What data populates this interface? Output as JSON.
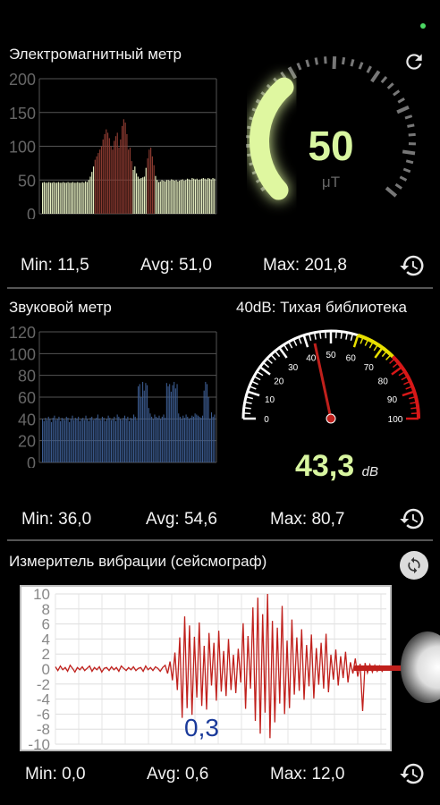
{
  "status": {
    "dot_color": "#4cd964"
  },
  "em": {
    "title": "Электромагнитный метр",
    "chart_data": {
      "type": "bar",
      "yticks": [
        "200",
        "150",
        "100",
        "50",
        "0"
      ],
      "ylim": [
        0,
        200
      ],
      "values": [
        46,
        47,
        46,
        46,
        47,
        46,
        46,
        47,
        46,
        46,
        47,
        46,
        46,
        47,
        46,
        46,
        47,
        46,
        46,
        47,
        46,
        46,
        47,
        46,
        46,
        47,
        46,
        48,
        47,
        50,
        55,
        62,
        70,
        80,
        85,
        90,
        95,
        100,
        110,
        118,
        125,
        120,
        112,
        100,
        95,
        108,
        115,
        120,
        98,
        110,
        130,
        140,
        135,
        118,
        95,
        98,
        78,
        65,
        70,
        60,
        55,
        52,
        53,
        54,
        55,
        68,
        82,
        95,
        98,
        85,
        72,
        56,
        50,
        47,
        48,
        50,
        49,
        48,
        50,
        50,
        49,
        51,
        50,
        49,
        50,
        48,
        49,
        50,
        51,
        49,
        50,
        52,
        51,
        50,
        53,
        52,
        51,
        52,
        50,
        51,
        52,
        53,
        52,
        51,
        53,
        52,
        51,
        53,
        52
      ],
      "threshold": 70,
      "colors": {
        "normal": "#e6efc2",
        "high": "#8a3a30"
      }
    },
    "gauge": {
      "value": "50",
      "unit": "μT",
      "fraction": 0.19
    },
    "stats": {
      "min": "Min: 11,5",
      "avg": "Avg: 51,0",
      "max": "Max: 201,8"
    }
  },
  "sound": {
    "title": "Звуковой метр",
    "status_text": "40dB: Тихая библиотека",
    "chart_data": {
      "type": "bar",
      "yticks": [
        "120",
        "100",
        "80",
        "60",
        "40",
        "20",
        "0"
      ],
      "ylim": [
        0,
        120
      ],
      "values": [
        40,
        38,
        41,
        39,
        42,
        40,
        37,
        41,
        43,
        39,
        40,
        42,
        38,
        41,
        40,
        39,
        42,
        41,
        37,
        40,
        43,
        39,
        41,
        40,
        42,
        38,
        40,
        41,
        39,
        43,
        40,
        38,
        41,
        42,
        39,
        40,
        41,
        44,
        40,
        39,
        42,
        41,
        38,
        40,
        43,
        41,
        39,
        40,
        42,
        38,
        44,
        42,
        40,
        39,
        41,
        43,
        40,
        42,
        38,
        41,
        40,
        44,
        42,
        39,
        70,
        72,
        60,
        74,
        66,
        73,
        71,
        50,
        45,
        42,
        40,
        44,
        42,
        41,
        43,
        40,
        42,
        44,
        41,
        73,
        70,
        72,
        65,
        71,
        74,
        68,
        72,
        45,
        42,
        40,
        43,
        41,
        44,
        42,
        40,
        41,
        43,
        42,
        45,
        44,
        43,
        42,
        41,
        43,
        66,
        74,
        72,
        60,
        40,
        46,
        42,
        44
      ]
    },
    "gauge": {
      "value": "43,3",
      "unit": "dB",
      "needle_value": 43.3,
      "labels": [
        "0",
        "10",
        "20",
        "30",
        "40",
        "50",
        "60",
        "70",
        "80",
        "90",
        "100"
      ]
    },
    "stats": {
      "min": "Min: 36,0",
      "avg": "Avg: 54,6",
      "max": "Max: 80,7"
    }
  },
  "vib": {
    "title": "Измеритель вибрации (сейсмограф)",
    "current": "0,3",
    "chart_data": {
      "type": "line",
      "yticks": [
        "10",
        "8",
        "6",
        "4",
        "2",
        "0",
        "-2",
        "-4",
        "-6",
        "-8",
        "-10"
      ],
      "ylim": [
        -10,
        10
      ],
      "values": [
        0.3,
        -0.2,
        0.4,
        -0.1,
        0.2,
        -0.3,
        0.5,
        0.1,
        -0.4,
        0.2,
        -0.1,
        0.3,
        -0.2,
        0.1,
        0.4,
        -0.3,
        0.2,
        -0.1,
        0.3,
        -0.4,
        0.1,
        0.2,
        -0.2,
        0.3,
        -0.1,
        0.2,
        -0.3,
        0.4,
        0.1,
        -0.2,
        0.2,
        -0.1,
        0.3,
        -0.2,
        0.1,
        0.2,
        -0.3,
        0.4,
        -0.1,
        0.2,
        -0.2,
        0.3,
        0.1,
        -0.3,
        0.2,
        0.5,
        -0.6,
        1.0,
        -1.5,
        2.2,
        -2.8,
        4.2,
        -6.5,
        7.0,
        -5.2,
        5.8,
        -6.1,
        4.3,
        -3.8,
        6.2,
        -4.9,
        3.1,
        -5.4,
        4.8,
        -2.2,
        3.5,
        -4.2,
        5.1,
        -3.0,
        2.4,
        -3.6,
        4.0,
        -2.8,
        1.9,
        -3.2,
        2.7,
        -1.8,
        6.1,
        -5.3,
        4.4,
        -2.6,
        8.2,
        -6.9,
        9.5,
        -8.6,
        7.3,
        -5.8,
        10.0,
        -9.2,
        6.4,
        -7.1,
        5.5,
        -4.6,
        8.4,
        -6.0,
        3.8,
        -5.2,
        6.6,
        -3.4,
        4.2,
        -2.9,
        5.3,
        -4.1,
        3.2,
        -2.3,
        4.6,
        -3.9,
        2.8,
        -2.1,
        3.5,
        -2.6,
        4.7,
        -3.1,
        1.9,
        -1.4,
        2.6,
        -2.2,
        1.7,
        -1.2,
        2.3,
        -1.8,
        0.9,
        -0.6,
        1.4,
        -1.0,
        0.7,
        -5.6,
        0.8,
        -0.5,
        0.6,
        -0.4,
        0.5,
        -0.3,
        0.4,
        -0.3,
        0.2
      ]
    },
    "stats": {
      "min": "Min: 0,0",
      "avg": "Avg: 0,6",
      "max": "Max: 12,0"
    }
  },
  "icons": {
    "refresh": "refresh-icon",
    "history": "history-icon",
    "sync": "sync-icon"
  }
}
